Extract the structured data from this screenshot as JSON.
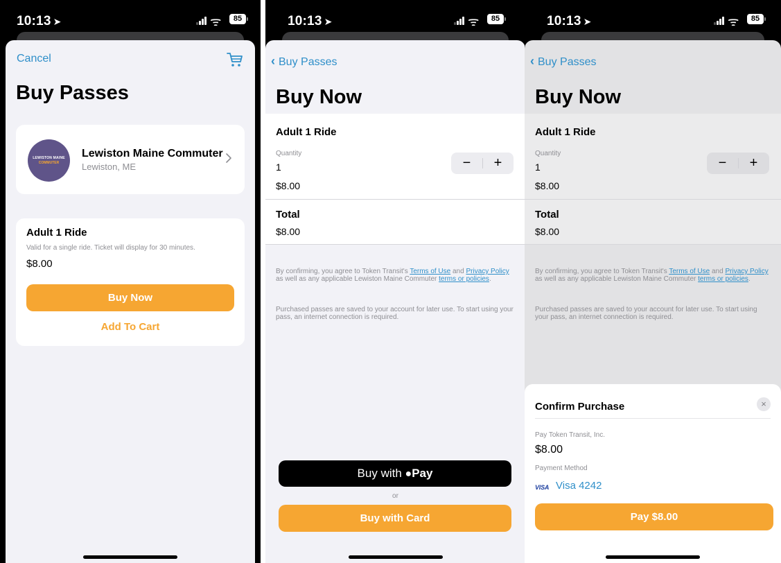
{
  "status_bar": {
    "time": "10:13",
    "battery": "85"
  },
  "screen1": {
    "nav": {
      "cancel_label": "Cancel"
    },
    "title": "Buy Passes",
    "agency": {
      "name": "Lewiston Maine Commuter",
      "location": "Lewiston, ME",
      "logo_line1": "LEWISTON MAINE",
      "logo_line2": "COMMUTER"
    },
    "pass": {
      "name": "Adult 1 Ride",
      "description": "Valid for a single ride. Ticket will display for 30 minutes.",
      "price": "$8.00",
      "buy_now_label": "Buy Now",
      "add_to_cart_label": "Add To Cart"
    }
  },
  "screen2": {
    "nav": {
      "back_label": "Buy Passes"
    },
    "title": "Buy Now",
    "item": {
      "name": "Adult 1 Ride",
      "quantity_label": "Quantity",
      "quantity": "1",
      "price": "$8.00",
      "minus": "−",
      "plus": "+"
    },
    "total": {
      "label": "Total",
      "value": "$8.00"
    },
    "legal": {
      "p1_a": "By confirming, you agree to Token Transit's ",
      "terms_link": "Terms of Use",
      "p1_b": " and ",
      "privacy_link": "Privacy Policy",
      "p1_c": " as well as any applicable Lewiston Maine Commuter ",
      "policies_link": "terms or policies",
      "p1_d": ".",
      "p2": "Purchased passes are saved to your account for later use. To start using your pass, an internet connection is required."
    },
    "apple_pay_label": "Buy with",
    "apple_pay_brand": "Pay",
    "or_label": "or",
    "card_label": "Buy with Card"
  },
  "screen3": {
    "confirm": {
      "title": "Confirm Purchase",
      "close": "×",
      "pay_to": "Pay Token Transit, Inc.",
      "amount": "$8.00",
      "method_label": "Payment Method",
      "card_brand": "VISA",
      "card": "Visa 4242",
      "pay_label": "Pay $8.00"
    }
  },
  "colors": {
    "accent_orange": "#f6a632",
    "link_blue": "#2f8fc9",
    "logo_purple": "#5f5489"
  }
}
